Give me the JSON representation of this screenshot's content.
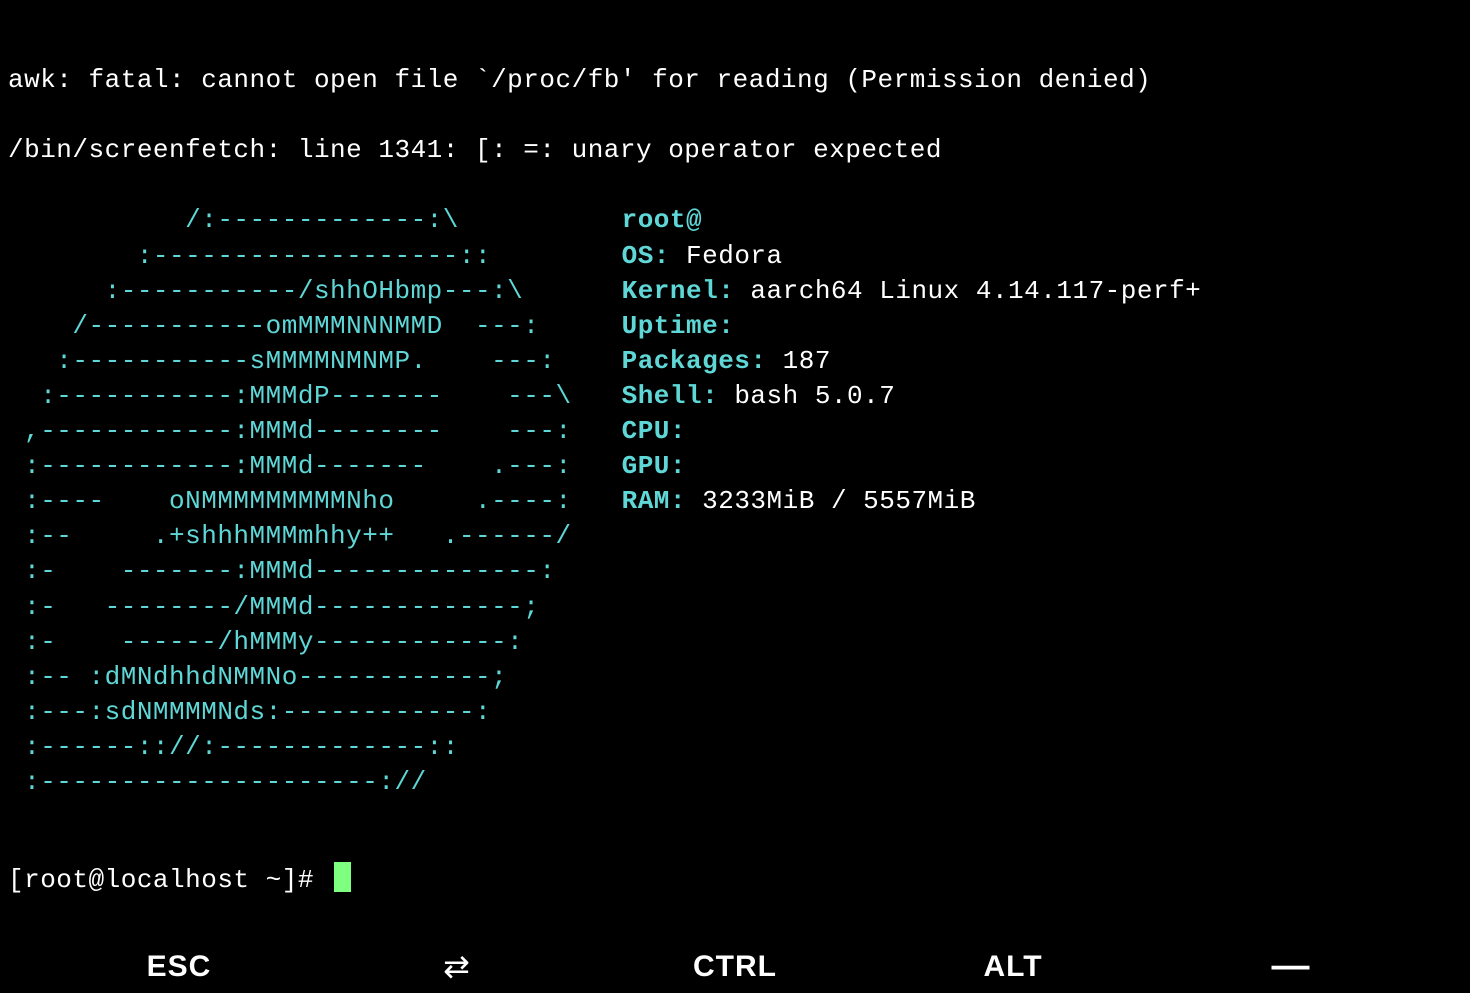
{
  "errors": {
    "line1": "awk: fatal: cannot open file `/proc/fb' for reading (Permission denied)",
    "line2": "/bin/screenfetch: line 1341: [: =: unary operator expected"
  },
  "ascii": {
    "l01": "           /:-------------:\\",
    "l02": "        :-------------------::",
    "l03": "      :-----------/shhOHbmp---:\\",
    "l04": "    /-----------omMMMNNNMMD  ---:",
    "l05": "   :-----------sMMMMNMNMP.    ---:",
    "l06": "  :-----------:MMMdP-------    ---\\",
    "l07": " ,------------:MMMd--------    ---:",
    "l08": " :------------:MMMd-------    .---:",
    "l09": " :----    oNMMMMMMMMMNho     .----:",
    "l10": " :--     .+shhhMMMmhhy++   .------/",
    "l11": " :-    -------:MMMd--------------:",
    "l12": " :-   --------/MMMd-------------;",
    "l13": " :-    ------/hMMMy------------:",
    "l14": " :-- :dMNdhhdNMMNo------------;",
    "l15": " :---:sdNMMMMNds:------------:",
    "l16": " :------:://:-------------::",
    "l17": " :---------------------://"
  },
  "info": {
    "userhost": "root@",
    "os_label": "OS:",
    "os_value": " Fedora ",
    "kernel_label": "Kernel:",
    "kernel_value": " aarch64 Linux 4.14.117-perf+",
    "uptime_label": "Uptime:",
    "uptime_value": " ",
    "packages_label": "Packages:",
    "packages_value": " 187",
    "shell_label": "Shell:",
    "shell_value": " bash 5.0.7",
    "cpu_label": "CPU:",
    "cpu_value": " ",
    "gpu_label": "GPU:",
    "gpu_value": " ",
    "ram_label": "RAM:",
    "ram_value": " 3233MiB / 5557MiB"
  },
  "prompt": "[root@localhost ~]# ",
  "keys": {
    "esc": "ESC",
    "swap": "⇄",
    "ctrl": "CTRL",
    "alt": "ALT",
    "dash": "—"
  }
}
